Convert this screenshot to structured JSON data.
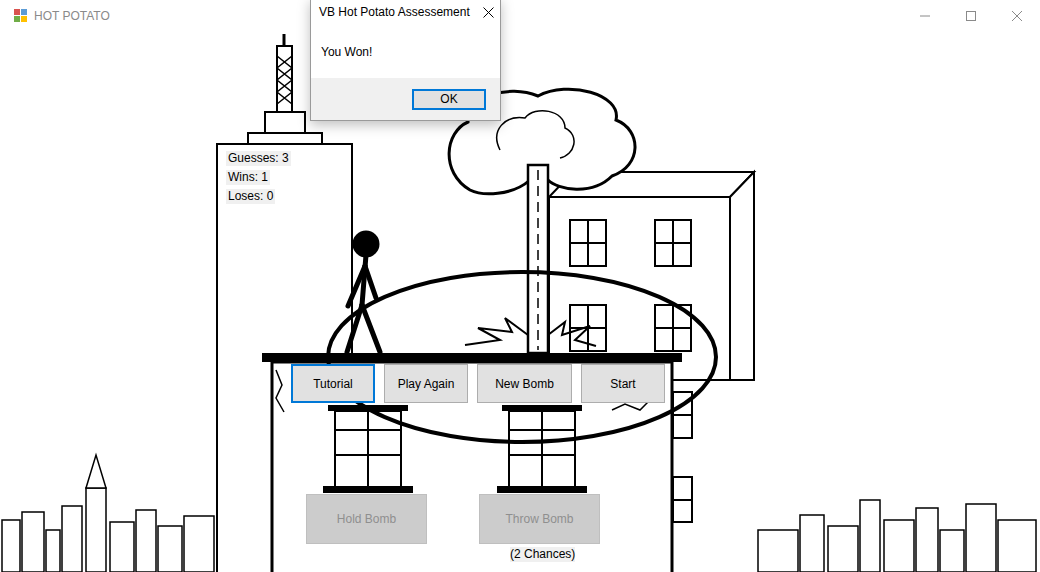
{
  "window": {
    "title": "HOT POTATO"
  },
  "dialog": {
    "title": "VB Hot Potato Assessement",
    "message": "You Won!",
    "button": "OK"
  },
  "stats": [
    {
      "label": "Guesses: 3"
    },
    {
      "label": "Wins: 1"
    },
    {
      "label": "Loses: 0"
    }
  ],
  "menu_buttons": [
    {
      "label": "Tutorial",
      "focused": true
    },
    {
      "label": "Play Again",
      "focused": false
    },
    {
      "label": "New Bomb",
      "focused": false
    },
    {
      "label": "Start",
      "focused": false
    }
  ],
  "action_buttons": [
    {
      "label": "Hold Bomb",
      "disabled": true
    },
    {
      "label": "Throw Bomb",
      "disabled": true
    }
  ],
  "chances": "(2 Chances)"
}
